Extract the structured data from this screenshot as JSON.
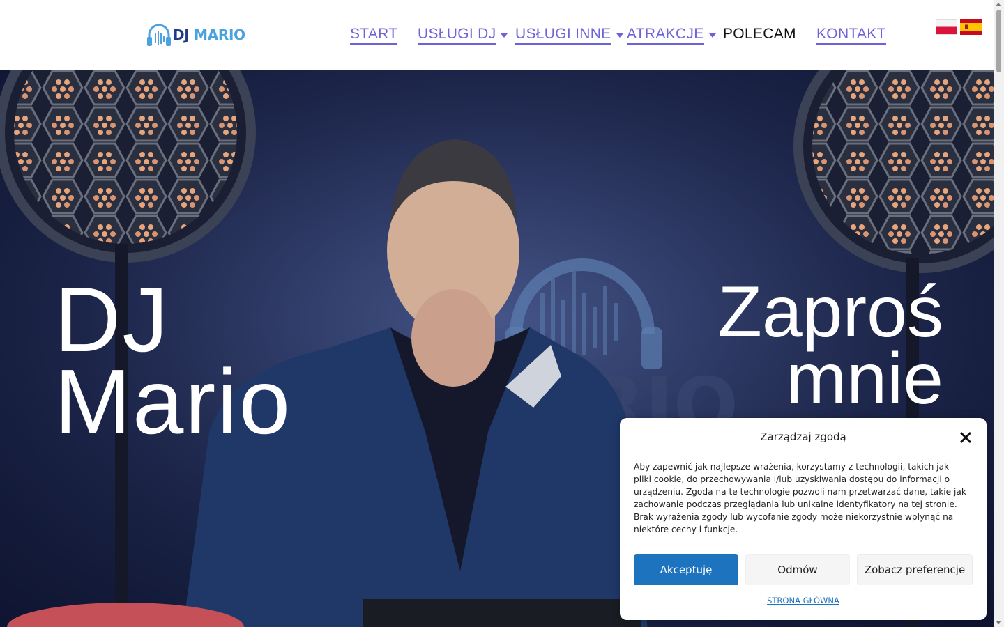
{
  "brand": {
    "dj": "DJ",
    "mario": "MARIO",
    "logo_icon": "headphones-waveform-icon"
  },
  "nav": {
    "items": [
      {
        "label": "START",
        "has_dropdown": false
      },
      {
        "label": "USŁUGI DJ",
        "has_dropdown": true
      },
      {
        "label": "USŁUGI INNE",
        "has_dropdown": true
      },
      {
        "label": "ATRAKCJE",
        "has_dropdown": true
      },
      {
        "label": "POLECAM",
        "has_dropdown": false
      },
      {
        "label": "KONTAKT",
        "has_dropdown": false
      }
    ],
    "link_color": "#6c63d9"
  },
  "languages": [
    {
      "icon": "flag-poland-icon"
    },
    {
      "icon": "flag-spain-icon"
    }
  ],
  "hero": {
    "title_left": [
      "DJ",
      "Mario"
    ],
    "title_right": [
      "Zaproś",
      "mnie"
    ]
  },
  "consent": {
    "title": "Zarządzaj zgodą",
    "body": "Aby zapewnić jak najlepsze wrażenia, korzystamy z technologii, takich jak pliki cookie, do przechowywania i/lub uzyskiwania dostępu do informacji o urządzeniu. Zgoda na te technologie pozwoli nam przetwarzać dane, takie jak zachowanie podczas przeglądania lub unikalne identyfikatory na tej stronie. Brak wyrażenia zgody lub wycofanie zgody może niekorzystnie wpłynąć na niektóre cechy i funkcje.",
    "accept_label": "Akceptuję",
    "deny_label": "Odmów",
    "prefs_label": "Zobacz preferencje",
    "link_label": "STRONA GŁÓWNA",
    "accent": "#1e73be"
  }
}
